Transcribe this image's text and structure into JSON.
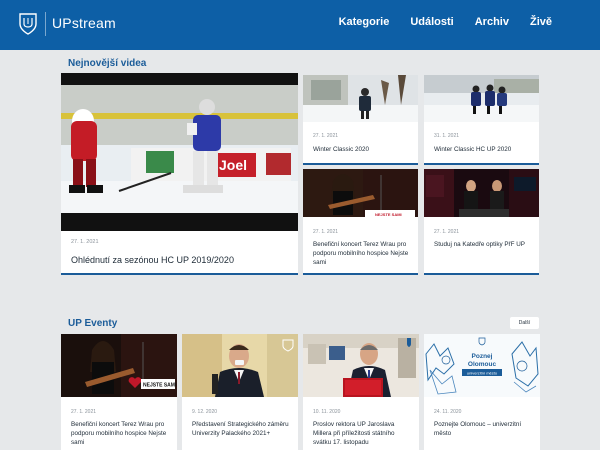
{
  "header": {
    "brand": "UPstream",
    "nav": [
      "Kategorie",
      "Události",
      "Archiv",
      "Živě"
    ]
  },
  "latest": {
    "heading": "Nejnovější videa",
    "featured": {
      "date": "27. 1. 2021",
      "title": "Ohlédnutí za sezónou HC UP 2019/2020"
    },
    "cards": [
      {
        "date": "27. 1. 2021",
        "title": "Winter Classic 2020"
      },
      {
        "date": "31. 1. 2021",
        "title": "Winter Classic HC UP 2020"
      },
      {
        "date": "27. 1. 2021",
        "title": "Benefiční koncert Terez Wrau pro podporu mobilního hospice Nejste sami"
      },
      {
        "date": "27. 1. 2021",
        "title": "Studuj na Katedře optiky PřF UP"
      }
    ]
  },
  "events": {
    "heading": "UP Eventy",
    "more": "Další",
    "cards": [
      {
        "date": "27. 1. 2021",
        "title": "Benefiční koncert Terez Wrau pro podporu mobilního hospice Nejste sami"
      },
      {
        "date": "9. 12. 2020",
        "title": "Představení Strategického záměru Univerzity Palackého 2021+"
      },
      {
        "date": "10. 11. 2020",
        "title": "Proslov rektora UP Jaroslava Millera při příležitosti státního svátku 17. listopadu"
      },
      {
        "date": "24. 11. 2020",
        "title": "Poznejte Olomouc – univerzitní město"
      }
    ]
  },
  "thumb_text": {
    "nejste_sami": "NEJSTE SAMI",
    "poznej": "Poznej",
    "olomouc": "Olomouc",
    "univerzitni": "univerzitní město",
    "joel": "Joel"
  },
  "colors": {
    "header": "#0d5fa6",
    "accent": "#1b5c99",
    "background": "#e6e8ea"
  }
}
